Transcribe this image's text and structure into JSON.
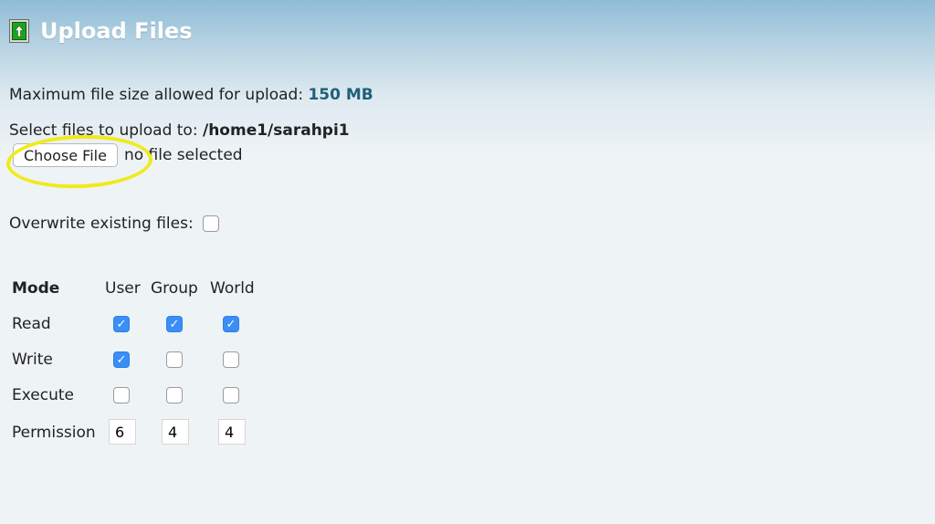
{
  "header": {
    "icon": "upload-arrow-icon",
    "title": "Upload Files"
  },
  "limits": {
    "max_label": "Maximum file size allowed for upload:",
    "max_value": "150 MB"
  },
  "target": {
    "label": "Select files to upload to:",
    "path": "/home1/sarahpi1"
  },
  "file_picker": {
    "button_label": "Choose File",
    "status": "no file selected"
  },
  "overwrite": {
    "label": "Overwrite existing files:",
    "checked": false
  },
  "permissions": {
    "header_mode": "Mode",
    "columns": [
      "User",
      "Group",
      "World"
    ],
    "rows": [
      {
        "label": "Read",
        "values": [
          true,
          true,
          true
        ]
      },
      {
        "label": "Write",
        "values": [
          true,
          false,
          false
        ]
      },
      {
        "label": "Execute",
        "values": [
          false,
          false,
          false
        ]
      }
    ],
    "permission_label": "Permission",
    "permission_values": [
      "6",
      "4",
      "4"
    ]
  },
  "colors": {
    "accent": "#1f5f7a",
    "checkbox_checked": "#3a8ef6",
    "highlight": "#f1ea1c"
  }
}
